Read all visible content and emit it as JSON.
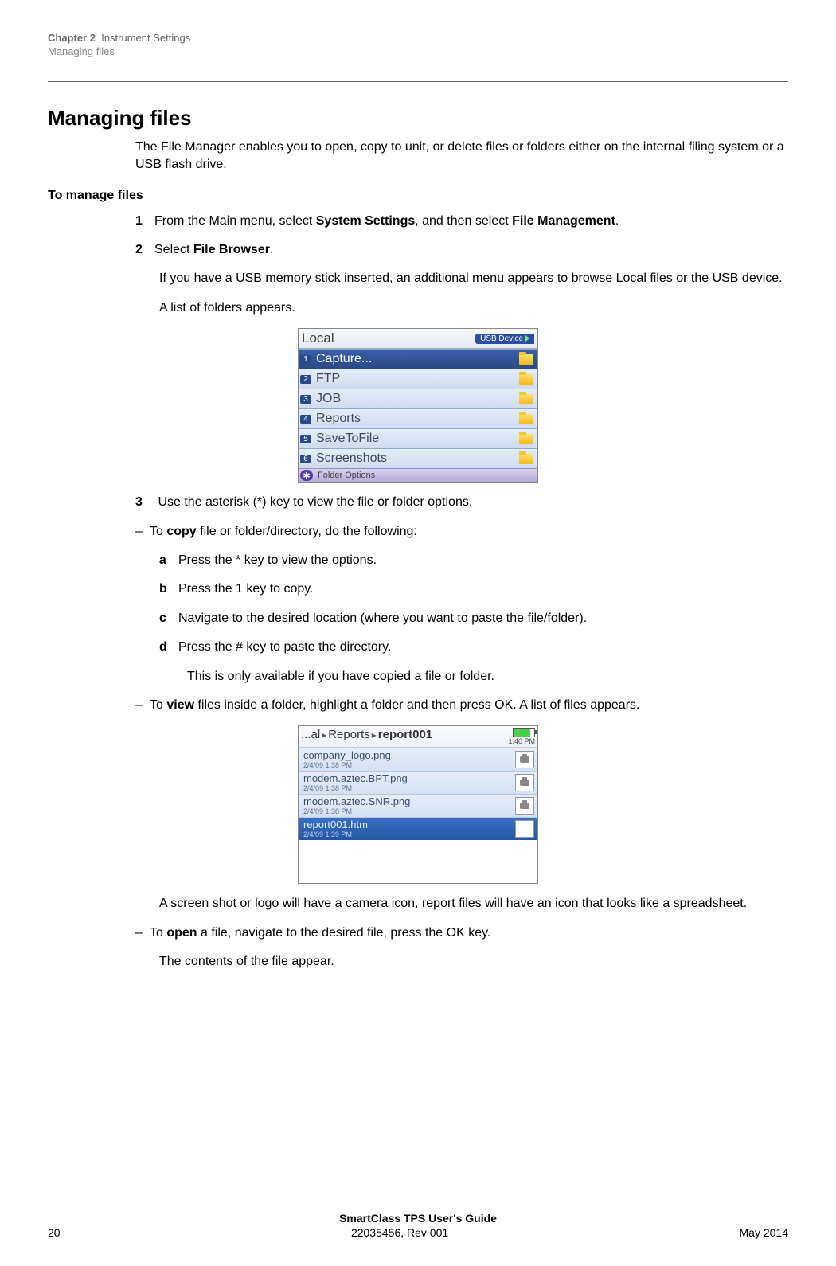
{
  "header": {
    "chapter_label": "Chapter 2",
    "chapter_title": "Instrument Settings",
    "section": "Managing files"
  },
  "title": "Managing files",
  "intro": "The File Manager enables you to open, copy to unit, or delete files or folders either on the internal filing system or a USB flash drive.",
  "subhead": "To manage files",
  "step1": {
    "num": "1",
    "text_pre": "From the Main menu, select ",
    "bold1": "System Settings",
    "mid": ", and then select ",
    "bold2": "File Management",
    "end": "."
  },
  "step2": {
    "num": "2",
    "text_pre": "Select ",
    "bold1": "File Browser",
    "end": ".",
    "para2": "If you have a USB memory stick inserted, an additional menu appears to browse Local files or the USB device.",
    "para3": "A list of folders appears."
  },
  "scr1": {
    "title": "Local",
    "usb": "USB Device",
    "rows": [
      {
        "n": "1",
        "label": "Capture..."
      },
      {
        "n": "2",
        "label": "FTP"
      },
      {
        "n": "3",
        "label": "JOB"
      },
      {
        "n": "4",
        "label": "Reports"
      },
      {
        "n": "5",
        "label": "SaveToFile"
      },
      {
        "n": "6",
        "label": "Screenshots"
      }
    ],
    "footer": "Folder Options"
  },
  "step3": {
    "num": "3",
    "text": " Use the asterisk (*) key to view the file or folder options."
  },
  "copy": {
    "lead_pre": "To ",
    "lead_bold": "copy",
    "lead_post": " file or folder/directory, do the following:",
    "a": "Press the * key to view the options.",
    "b": "Press the 1 key to copy.",
    "c": "Navigate to the desired location (where you want to paste the file/folder).",
    "d": "Press the # key to paste the directory.",
    "note": "This is only available if you have copied a file or folder."
  },
  "view": {
    "lead_pre": "To ",
    "lead_bold": "view",
    "lead_post": " files inside a folder, highlight a folder and then press OK. A list of files appears."
  },
  "scr2": {
    "bc1": "...al",
    "bc2": "Reports",
    "bc3": "report001",
    "time": "1:40 PM",
    "rows": [
      {
        "name": "company_logo.png",
        "ts": "2/4/09 1:38 PM",
        "sel": false
      },
      {
        "name": "modem.aztec.BPT.png",
        "ts": "2/4/09 1:38 PM",
        "sel": false
      },
      {
        "name": "modem.aztec.SNR.png",
        "ts": "2/4/09 1:38 PM",
        "sel": false
      },
      {
        "name": "report001.htm",
        "ts": "2/4/09 1:39 PM",
        "sel": true
      }
    ]
  },
  "after_scr2": "A screen shot or logo will have a camera icon, report files will have an icon that looks like a spreadsheet.",
  "open": {
    "lead_pre": "To ",
    "lead_bold": "open",
    "lead_post": " a file, navigate to the desired file, press the OK key.",
    "para2": "The contents of the file appear."
  },
  "footer": {
    "title": "SmartClass TPS User's Guide",
    "page": "20",
    "docnum": "22035456, Rev 001",
    "date": "May 2014"
  }
}
